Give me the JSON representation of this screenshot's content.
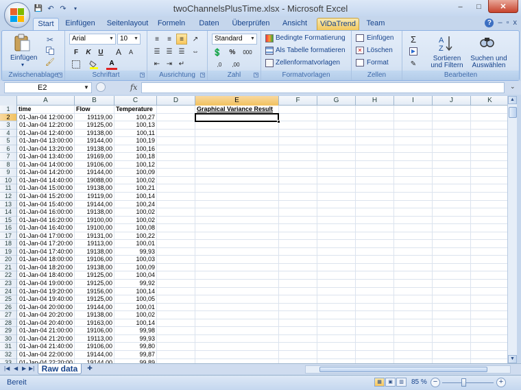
{
  "window": {
    "title": "twoChannelsPlusTime.xlsx - Microsoft Excel",
    "minimize": "–",
    "maximize": "□",
    "close": "✕"
  },
  "qat": {
    "save": "💾",
    "undo": "↶",
    "redo": "↷",
    "more": "▾"
  },
  "tabs": [
    {
      "label": "Start",
      "active": true
    },
    {
      "label": "Einfügen"
    },
    {
      "label": "Seitenlayout"
    },
    {
      "label": "Formeln"
    },
    {
      "label": "Daten"
    },
    {
      "label": "Überprüfen"
    },
    {
      "label": "Ansicht"
    },
    {
      "label": "ViDaTrend",
      "highlight": true
    },
    {
      "label": "Team"
    }
  ],
  "mdi": {
    "help": "?",
    "min": "–",
    "restore": "▫",
    "close": "x"
  },
  "ribbon": {
    "clipboard": {
      "label": "Zwischenablage",
      "paste": "Einfügen"
    },
    "font": {
      "label": "Schriftart",
      "name": "Arial",
      "size": "10",
      "bold": "F",
      "italic": "K",
      "underline": "U",
      "grow": "A",
      "shrink": "A"
    },
    "alignment": {
      "label": "Ausrichtung"
    },
    "number": {
      "label": "Zahl",
      "format": "Standard",
      "percent": "%",
      "thousands": "000",
      "inc": ",0",
      "dec": ",00"
    },
    "styles": {
      "label": "Formatvorlagen",
      "conditional": "Bedingte Formatierung",
      "as_table": "Als Tabelle formatieren",
      "cell_styles": "Zellenformatvorlagen"
    },
    "cells": {
      "label": "Zellen",
      "insert": "Einfügen",
      "delete": "Löschen",
      "format": "Format"
    },
    "editing": {
      "label": "Bearbeiten",
      "sort": "Sortieren und Filtern",
      "find": "Suchen und Auswählen"
    }
  },
  "formula_bar": {
    "name_box": "E2",
    "fx": "fx",
    "content": ""
  },
  "columns": [
    "A",
    "B",
    "C",
    "D",
    "E",
    "F",
    "G",
    "H",
    "I",
    "J",
    "K"
  ],
  "selected_column": "E",
  "selected_row": 2,
  "headers": {
    "time": "time",
    "flow": "Flow",
    "temperature": "Temperature",
    "result": "Graphical Variance Result"
  },
  "rows": [
    [
      "01-Jan-04 12:00:00",
      "19119,00",
      "100,27"
    ],
    [
      "01-Jan-04 12:20:00",
      "19125,00",
      "100,13"
    ],
    [
      "01-Jan-04 12:40:00",
      "19138,00",
      "100,11"
    ],
    [
      "01-Jan-04 13:00:00",
      "19144,00",
      "100,19"
    ],
    [
      "01-Jan-04 13:20:00",
      "19138,00",
      "100,16"
    ],
    [
      "01-Jan-04 13:40:00",
      "19169,00",
      "100,18"
    ],
    [
      "01-Jan-04 14:00:00",
      "19106,00",
      "100,12"
    ],
    [
      "01-Jan-04 14:20:00",
      "19144,00",
      "100,09"
    ],
    [
      "01-Jan-04 14:40:00",
      "19088,00",
      "100,02"
    ],
    [
      "01-Jan-04 15:00:00",
      "19138,00",
      "100,21"
    ],
    [
      "01-Jan-04 15:20:00",
      "19119,00",
      "100,14"
    ],
    [
      "01-Jan-04 15:40:00",
      "19144,00",
      "100,24"
    ],
    [
      "01-Jan-04 16:00:00",
      "19138,00",
      "100,02"
    ],
    [
      "01-Jan-04 16:20:00",
      "19100,00",
      "100,02"
    ],
    [
      "01-Jan-04 16:40:00",
      "19100,00",
      "100,08"
    ],
    [
      "01-Jan-04 17:00:00",
      "19131,00",
      "100,22"
    ],
    [
      "01-Jan-04 17:20:00",
      "19113,00",
      "100,01"
    ],
    [
      "01-Jan-04 17:40:00",
      "19138,00",
      "99,93"
    ],
    [
      "01-Jan-04 18:00:00",
      "19106,00",
      "100,03"
    ],
    [
      "01-Jan-04 18:20:00",
      "19138,00",
      "100,09"
    ],
    [
      "01-Jan-04 18:40:00",
      "19125,00",
      "100,04"
    ],
    [
      "01-Jan-04 19:00:00",
      "19125,00",
      "99,92"
    ],
    [
      "01-Jan-04 19:20:00",
      "19156,00",
      "100,14"
    ],
    [
      "01-Jan-04 19:40:00",
      "19125,00",
      "100,05"
    ],
    [
      "01-Jan-04 20:00:00",
      "19144,00",
      "100,01"
    ],
    [
      "01-Jan-04 20:20:00",
      "19138,00",
      "100,02"
    ],
    [
      "01-Jan-04 20:40:00",
      "19163,00",
      "100,14"
    ],
    [
      "01-Jan-04 21:00:00",
      "19106,00",
      "99,98"
    ],
    [
      "01-Jan-04 21:20:00",
      "19113,00",
      "99,93"
    ],
    [
      "01-Jan-04 21:40:00",
      "19106,00",
      "99,80"
    ],
    [
      "01-Jan-04 22:00:00",
      "19144,00",
      "99,87"
    ],
    [
      "01-Jan-04 22:20:00",
      "19144,00",
      "99,89"
    ]
  ],
  "sheet": {
    "tab": "Raw data"
  },
  "status": {
    "text": "Bereit",
    "zoom": "85 %"
  },
  "colors": {
    "accent": "#15428b",
    "selection": "#f1c15f",
    "ribbon": "#dbe6f4"
  }
}
